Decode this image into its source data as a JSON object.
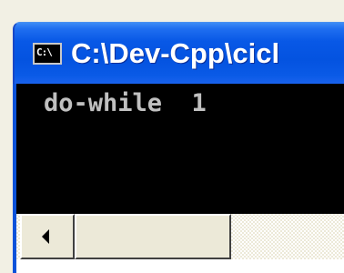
{
  "window": {
    "title": "C:\\Dev-Cpp\\cicl",
    "icon_label": "C:\\",
    "icon": "console-window-icon"
  },
  "console": {
    "output_line": "do-while  1"
  },
  "scrollbar": {
    "left_arrow_icon": "scroll-left-arrow-icon"
  },
  "colors": {
    "titlebar": "#0453e0",
    "console_bg": "#000000",
    "console_text": "#c0c0c0",
    "frame": "#ece9d8"
  }
}
